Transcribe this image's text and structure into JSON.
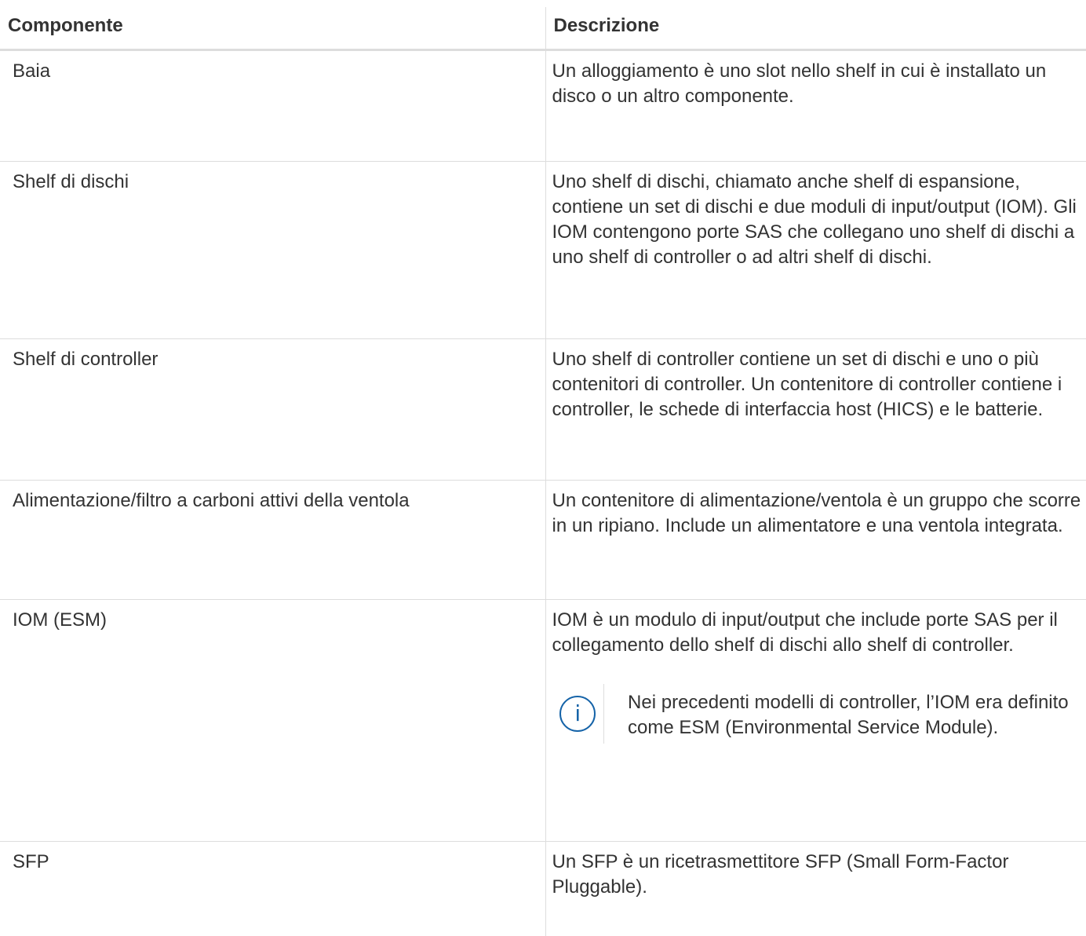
{
  "table": {
    "headers": [
      "Componente",
      "Descrizione"
    ],
    "rows": [
      {
        "component": "Baia",
        "description": "Un alloggiamento è uno slot nello shelf in cui è installato un disco o un altro componente."
      },
      {
        "component": "Shelf di dischi",
        "description": "Uno shelf di dischi, chiamato anche shelf di espansione, contiene un set di dischi e due moduli di input/output (IOM). Gli IOM contengono porte SAS che collegano uno shelf di dischi a uno shelf di controller o ad altri shelf di dischi."
      },
      {
        "component": "Shelf di controller",
        "description": "Uno shelf di controller contiene un set di dischi e uno o più contenitori di controller. Un contenitore di controller contiene i controller, le schede di interfaccia host (HICS) e le batterie."
      },
      {
        "component": "Alimentazione/filtro a carboni attivi della ventola",
        "description": "Un contenitore di alimentazione/ventola è un gruppo che scorre in un ripiano. Include un alimentatore e una ventola integrata."
      },
      {
        "component": "IOM (ESM)",
        "description": "IOM è un modulo di input/output che include porte SAS per il collegamento dello shelf di dischi allo shelf di controller.",
        "note": {
          "icon": "info-icon",
          "glyph": "i",
          "text": "Nei precedenti modelli di controller, l’IOM era definito come ESM (Environmental Service Module)."
        }
      },
      {
        "component": "SFP",
        "description": "Un SFP è un ricetrasmettitore SFP (Small Form-Factor Pluggable)."
      }
    ]
  },
  "colors": {
    "text": "#333333",
    "border": "#dddddd",
    "info_icon": "#1563a8"
  }
}
